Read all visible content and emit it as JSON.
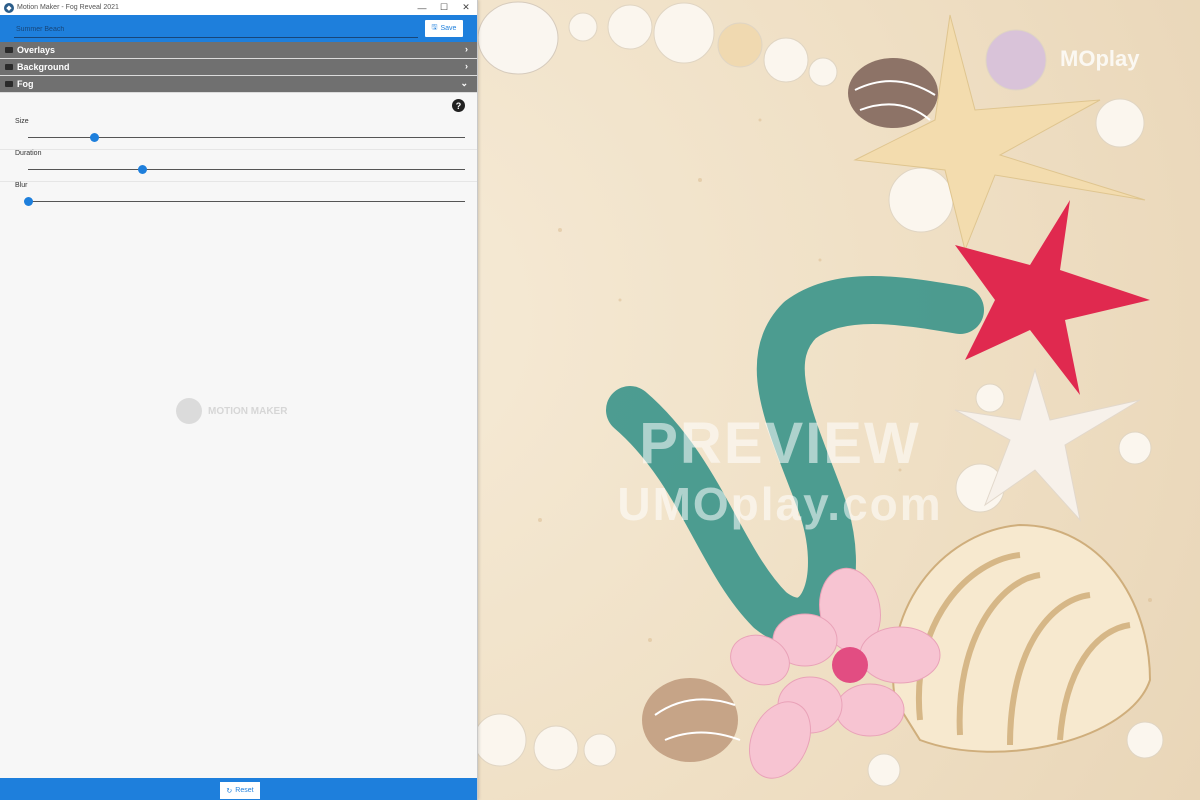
{
  "window": {
    "title": "Motion Maker - Fog Reveal 2021"
  },
  "topbar": {
    "project_name": "Summer Beach",
    "save_label": "Save"
  },
  "sections": [
    {
      "label": "Overlays",
      "expanded": false
    },
    {
      "label": "Background",
      "expanded": false
    },
    {
      "label": "Fog",
      "expanded": true
    }
  ],
  "fog": {
    "sliders": [
      {
        "label": "Size",
        "value_pct": 15
      },
      {
        "label": "Duration",
        "value_pct": 26
      },
      {
        "label": "Blur",
        "value_pct": 0
      }
    ]
  },
  "watermark": {
    "center_text": "MOTION MAKER"
  },
  "bottombar": {
    "reset_label": "Reset"
  },
  "preview": {
    "watermark_text": "PREVIEW",
    "watermark_url": "UMOplay.com",
    "brand": "MOplay"
  },
  "colors": {
    "accent": "#1e7fdc",
    "section_bg": "#707070"
  }
}
